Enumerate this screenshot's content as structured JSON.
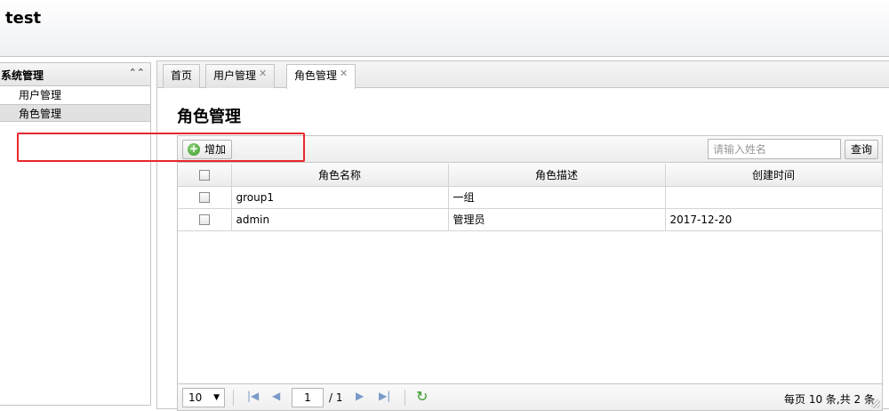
{
  "app": {
    "title": "test"
  },
  "sidebar": {
    "header": "系统管理",
    "collapse_icon": "double-chevron-up-icon",
    "items": [
      {
        "label": "用户管理"
      },
      {
        "label": "角色管理",
        "active": true
      }
    ]
  },
  "tabs": [
    {
      "label": "首页",
      "closable": false
    },
    {
      "label": "用户管理",
      "closable": true
    },
    {
      "label": "角色管理",
      "closable": true,
      "active": true
    }
  ],
  "tab_close_glyph": "✕",
  "page": {
    "title": "角色管理"
  },
  "toolbar": {
    "add_label": "增加",
    "search_placeholder": "请输入姓名",
    "search_value": "",
    "search_button": "查询"
  },
  "table": {
    "columns": [
      "角色名称",
      "角色描述",
      "创建时间"
    ],
    "rows": [
      {
        "name": "group1",
        "desc": "一组",
        "created": ""
      },
      {
        "name": "admin",
        "desc": "管理员",
        "created": "2017-12-20"
      }
    ]
  },
  "pager": {
    "page_size": "10",
    "page": "1",
    "of_pages": "/ 1",
    "info": "每页 10 条,共 2 条"
  },
  "colors": {
    "highlight": "#e8262b",
    "accent_green": "#3c9b2b",
    "nav_blue": "#7a9bc9"
  }
}
